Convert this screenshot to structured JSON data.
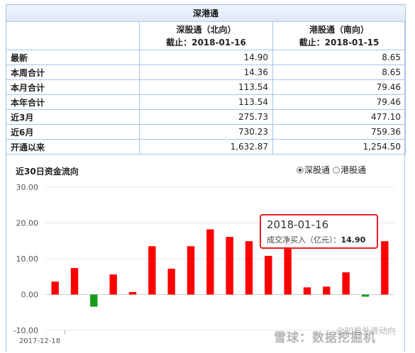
{
  "table": {
    "title": "深港通",
    "columns": [
      {
        "name": "深股通（北向）",
        "date": "截止：2018-01-16"
      },
      {
        "name": "港股通（南向）",
        "date": "截止：2018-01-15"
      }
    ],
    "rows": [
      {
        "label": "最新",
        "north": "14.90",
        "south": "8.65"
      },
      {
        "label": "本周合计",
        "north": "14.36",
        "south": "8.65"
      },
      {
        "label": "本月合计",
        "north": "113.54",
        "south": "79.46"
      },
      {
        "label": "本年合计",
        "north": "113.54",
        "south": "79.46"
      },
      {
        "label": "近3月",
        "north": "275.73",
        "south": "477.10"
      },
      {
        "label": "近6月",
        "north": "730.23",
        "south": "759.36"
      },
      {
        "label": "开通以来",
        "north": "1,632.87",
        "south": "1,254.50"
      }
    ]
  },
  "chart_header": {
    "title": "近30日资金流向",
    "options": [
      {
        "label": "深股通",
        "selected": true
      },
      {
        "label": "港股通",
        "selected": false
      }
    ]
  },
  "tooltip": {
    "date": "2018-01-16",
    "label": "成交净买入（亿元）：",
    "value": "14.90"
  },
  "watermark": {
    "main": "雪球：数据挖掘机",
    "sub": "@知看外资动向"
  },
  "colors": {
    "positive": "#ff0000",
    "negative": "#1a9a1a",
    "border": "#a9c4e6",
    "tooltip_border": "#e02020"
  },
  "chart_data": {
    "type": "bar",
    "x_first_label": "2017-12-18",
    "ylim": [
      -10,
      30
    ],
    "yticks": [
      "30.00",
      "20.00",
      "10.00",
      "0.00",
      "-10.00"
    ],
    "values": [
      3.6,
      7.4,
      -3.4,
      5.6,
      0.7,
      13.5,
      7.2,
      13.5,
      18.2,
      16.1,
      14.9,
      10.8,
      14.4,
      2.0,
      2.2,
      6.2,
      -0.6,
      14.9
    ]
  }
}
